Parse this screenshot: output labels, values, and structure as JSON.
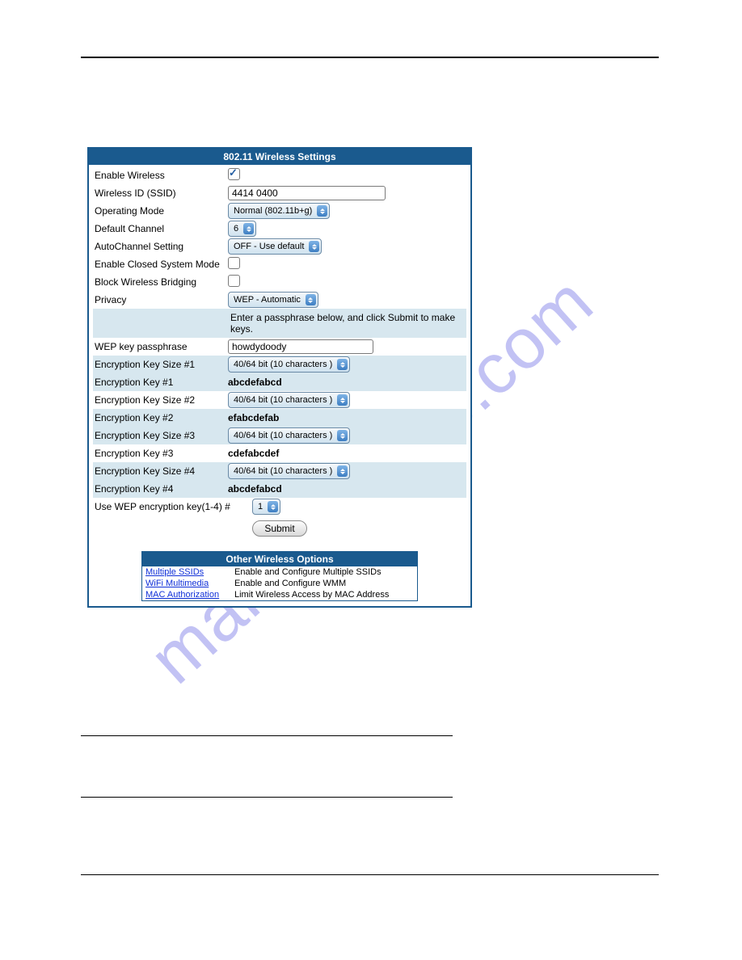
{
  "watermark": "manualshive.com",
  "panel": {
    "title": "802.11 Wireless Settings",
    "enable_wireless_label": "Enable Wireless",
    "enable_wireless_checked": true,
    "ssid_label": "Wireless ID (SSID)",
    "ssid_value": "4414 0400",
    "operating_mode_label": "Operating Mode",
    "operating_mode_value": "Normal (802.11b+g)",
    "default_channel_label": "Default Channel",
    "default_channel_value": "6",
    "autochannel_label": "AutoChannel Setting",
    "autochannel_value": "OFF - Use default",
    "closed_system_label": "Enable Closed System Mode",
    "closed_system_checked": false,
    "block_bridging_label": "Block Wireless Bridging",
    "block_bridging_checked": false,
    "privacy_label": "Privacy",
    "privacy_value": "WEP - Automatic",
    "instruction": "Enter a passphrase below, and click Submit to make keys.",
    "passphrase_label": "WEP key passphrase",
    "passphrase_value": "howdydoody",
    "enc_size_label_1": "Encryption Key Size #1",
    "enc_size_value_1": "40/64 bit (10 characters )",
    "enc_key_label_1": "Encryption Key #1",
    "enc_key_value_1": "abcdefabcd",
    "enc_size_label_2": "Encryption Key Size #2",
    "enc_size_value_2": "40/64 bit (10 characters )",
    "enc_key_label_2": "Encryption Key #2",
    "enc_key_value_2": "efabcdefab",
    "enc_size_label_3": "Encryption Key Size #3",
    "enc_size_value_3": "40/64 bit (10 characters )",
    "enc_key_label_3": "Encryption Key #3",
    "enc_key_value_3": "cdefabcdef",
    "enc_size_label_4": "Encryption Key Size #4",
    "enc_size_value_4": "40/64 bit (10 characters )",
    "enc_key_label_4": "Encryption Key #4",
    "enc_key_value_4": "abcdefabcd",
    "use_key_label": "Use WEP encryption key(1-4) #",
    "use_key_value": "1",
    "submit_label": "Submit"
  },
  "other": {
    "title": "Other Wireless Options",
    "rows": [
      {
        "link": "Multiple SSIDs",
        "desc": "Enable and Configure Multiple SSIDs"
      },
      {
        "link": "WiFi Multimedia",
        "desc": "Enable and Configure WMM"
      },
      {
        "link": "MAC Authorization",
        "desc": "Limit Wireless Access by MAC Address"
      }
    ]
  }
}
